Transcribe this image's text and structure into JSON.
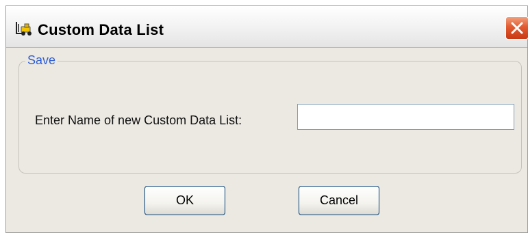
{
  "window": {
    "title": "Custom Data List",
    "app_icon": "forklift-icon",
    "close_icon": "close-icon"
  },
  "group": {
    "legend": "Save"
  },
  "form": {
    "name_label": "Enter Name of new Custom Data List:",
    "name_value": ""
  },
  "buttons": {
    "ok_label": "OK",
    "cancel_label": "Cancel"
  },
  "colors": {
    "window_bg": "#ece9e3",
    "legend_text": "#2f5fd4",
    "close_button": "#e25a2f",
    "button_border": "#003c74"
  }
}
